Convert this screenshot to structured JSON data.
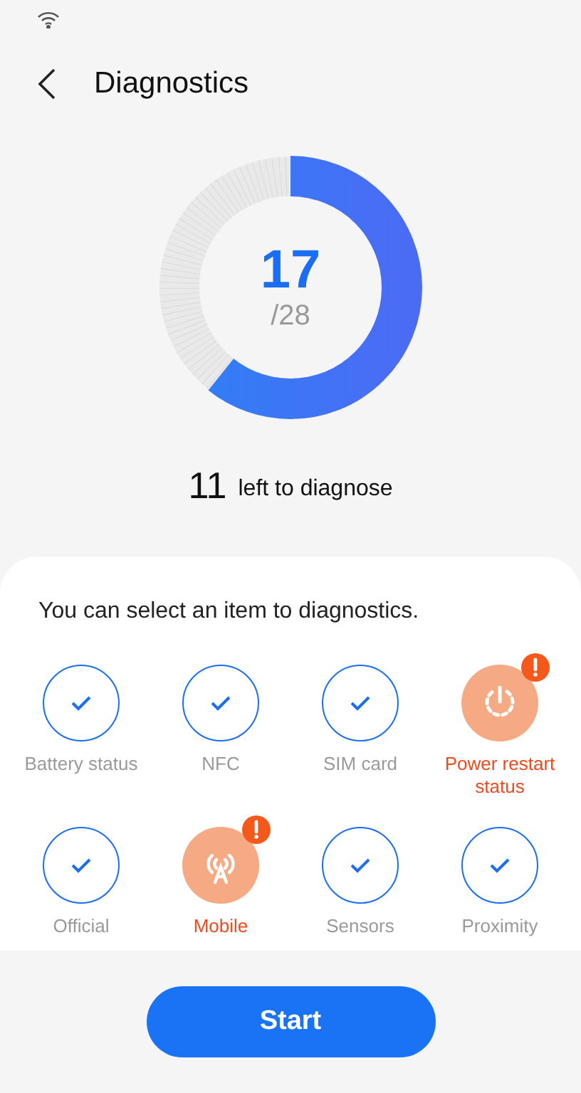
{
  "header": {
    "title": "Diagnostics"
  },
  "progress": {
    "done": "17",
    "total": "/28"
  },
  "remaining": {
    "count": "11",
    "label": "left to diagnose"
  },
  "prompt": "You can select an item to diagnostics.",
  "items": [
    {
      "label": "Battery status",
      "kind": "passed"
    },
    {
      "label": "NFC",
      "kind": "passed"
    },
    {
      "label": "SIM card",
      "kind": "passed"
    },
    {
      "label": "Power restart status",
      "kind": "power"
    },
    {
      "label": "Official",
      "kind": "passed"
    },
    {
      "label": "Mobile",
      "kind": "antenna"
    },
    {
      "label": "Sensors",
      "kind": "passed"
    },
    {
      "label": "Proximity",
      "kind": "passed"
    }
  ],
  "button": "Start"
}
